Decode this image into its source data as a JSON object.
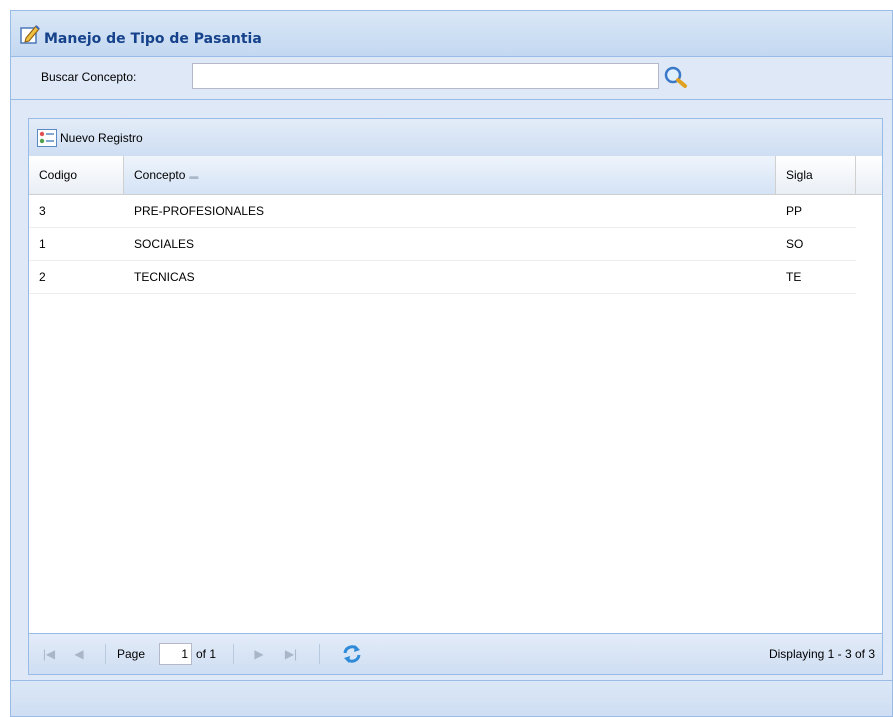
{
  "window": {
    "title": "Manejo de Tipo de Pasantia",
    "title_icon": "edit-icon"
  },
  "search": {
    "label": "Buscar Concepto:",
    "value": "",
    "button_icon": "search-icon"
  },
  "toolbar": {
    "new_record_label": "Nuevo Registro",
    "new_record_icon": "form-icon"
  },
  "grid": {
    "columns": [
      "Codigo",
      "Concepto",
      "Sigla"
    ],
    "sorted_column": "Concepto",
    "rows": [
      {
        "codigo": "3",
        "concepto": "PRE-PROFESIONALES",
        "sigla": "PP"
      },
      {
        "codigo": "1",
        "concepto": "SOCIALES",
        "sigla": "SO"
      },
      {
        "codigo": "2",
        "concepto": "TECNICAS",
        "sigla": "TE"
      }
    ]
  },
  "pager": {
    "page_label": "Page",
    "page_value": "1",
    "of_label": "of 1",
    "display_text": "Displaying 1 - 3 of 3"
  },
  "colors": {
    "header_text": "#15428b",
    "border": "#99bbe8",
    "panel_bg": "#dfe8f6"
  }
}
